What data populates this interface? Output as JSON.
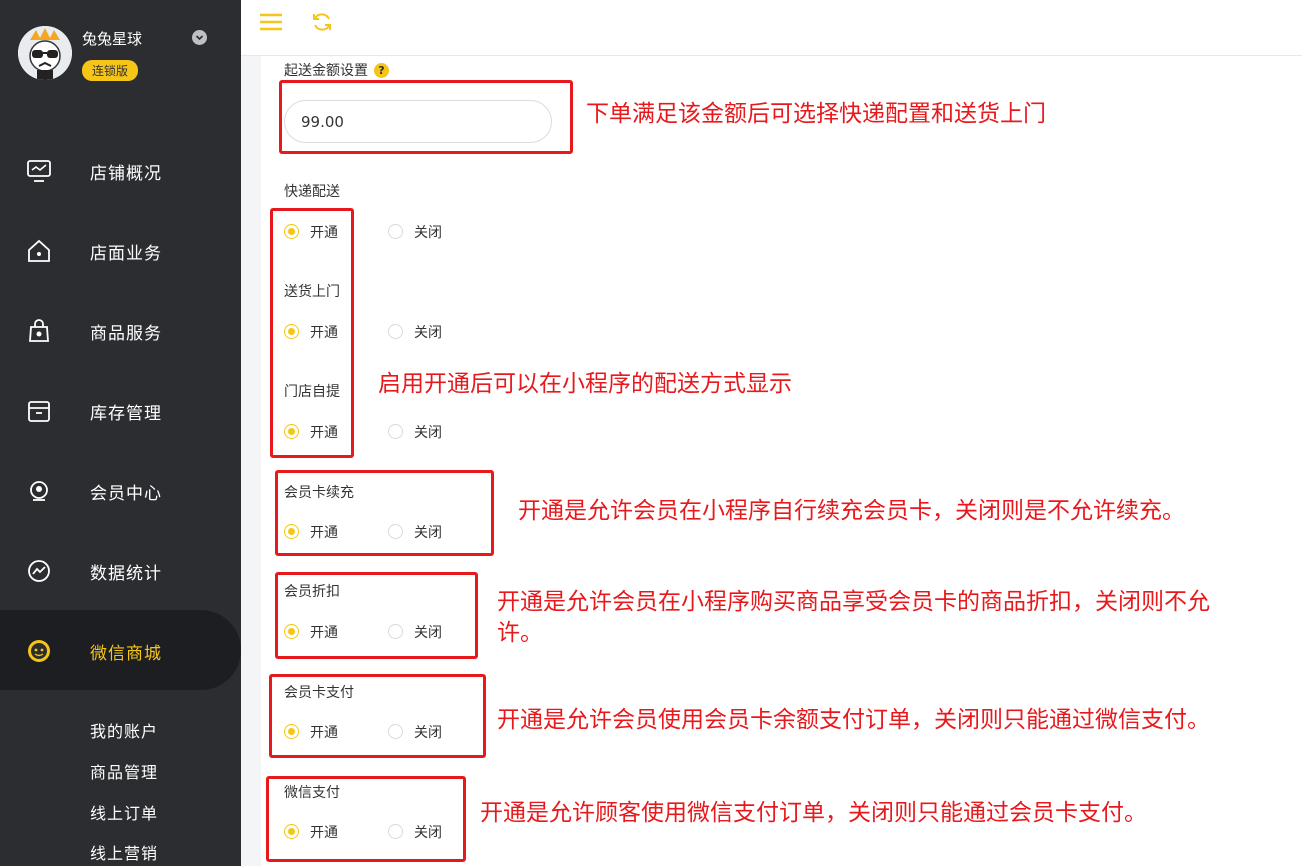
{
  "sidebar": {
    "shop_name": "兔兔星球",
    "badge": "连锁版",
    "items": [
      {
        "label": "店铺概况",
        "icon": "monitor-icon"
      },
      {
        "label": "店面业务",
        "icon": "home-icon"
      },
      {
        "label": "商品服务",
        "icon": "bag-icon"
      },
      {
        "label": "库存管理",
        "icon": "archive-icon"
      },
      {
        "label": "会员中心",
        "icon": "member-icon"
      },
      {
        "label": "数据统计",
        "icon": "chart-icon"
      },
      {
        "label": "微信商城",
        "icon": "wechat-icon"
      }
    ],
    "sub_items": [
      "我的账户",
      "商品管理",
      "线上订单",
      "线上营销"
    ],
    "accent": "#f5c518"
  },
  "form": {
    "amount_label": "起送金额设置",
    "help": "?",
    "amount_value": "99.00",
    "open_label": "开通",
    "close_label": "关闭",
    "sections": [
      {
        "label": "快递配送",
        "selected": "开通"
      },
      {
        "label": "送货上门",
        "selected": "开通"
      },
      {
        "label": "门店自提",
        "selected": "开通"
      },
      {
        "label": "会员卡续充",
        "selected": "开通"
      },
      {
        "label": "会员折扣",
        "selected": "开通"
      },
      {
        "label": "会员卡支付",
        "selected": "开通"
      },
      {
        "label": "微信支付",
        "selected": "开通"
      }
    ]
  },
  "notes": {
    "amount": "下单满足该金额后可选择快递配置和送货上门",
    "delivery": "启用开通后可以在小程序的配送方式显示",
    "recharge": "开通是允许会员在小程序自行续充会员卡，关闭则是不允许续充。",
    "discount_line1": "开通是允许会员在小程序购买商品享受会员卡的商品折扣，关闭则不允",
    "discount_line2": "许。",
    "card_pay": "开通是允许会员使用会员卡余额支付订单，关闭则只能通过微信支付。",
    "wechat_pay": "开通是允许顾客使用微信支付订单，关闭则只能通过会员卡支付。"
  },
  "colors": {
    "sidebar_bg": "#2c2d31",
    "annotation_red": "#e8191c",
    "radio_active": "#f5c518"
  }
}
